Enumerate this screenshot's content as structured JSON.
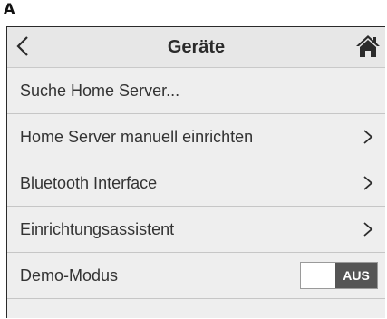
{
  "figure_label": "A",
  "header": {
    "title": "Geräte",
    "back_icon": "chevron-left-icon",
    "home_icon": "home-icon"
  },
  "menu": {
    "items": [
      {
        "label": "Suche Home Server...",
        "has_chevron": false
      },
      {
        "label": "Home Server manuell einrichten",
        "has_chevron": true
      },
      {
        "label": "Bluetooth Interface",
        "has_chevron": true
      },
      {
        "label": "Einrichtungsassistent",
        "has_chevron": true
      }
    ],
    "demo": {
      "label": "Demo-Modus",
      "toggle_state": "AUS",
      "on": false
    }
  },
  "colors": {
    "background": "#eeeeee",
    "toggle_off": "#555555",
    "text": "#2b2b2b"
  }
}
